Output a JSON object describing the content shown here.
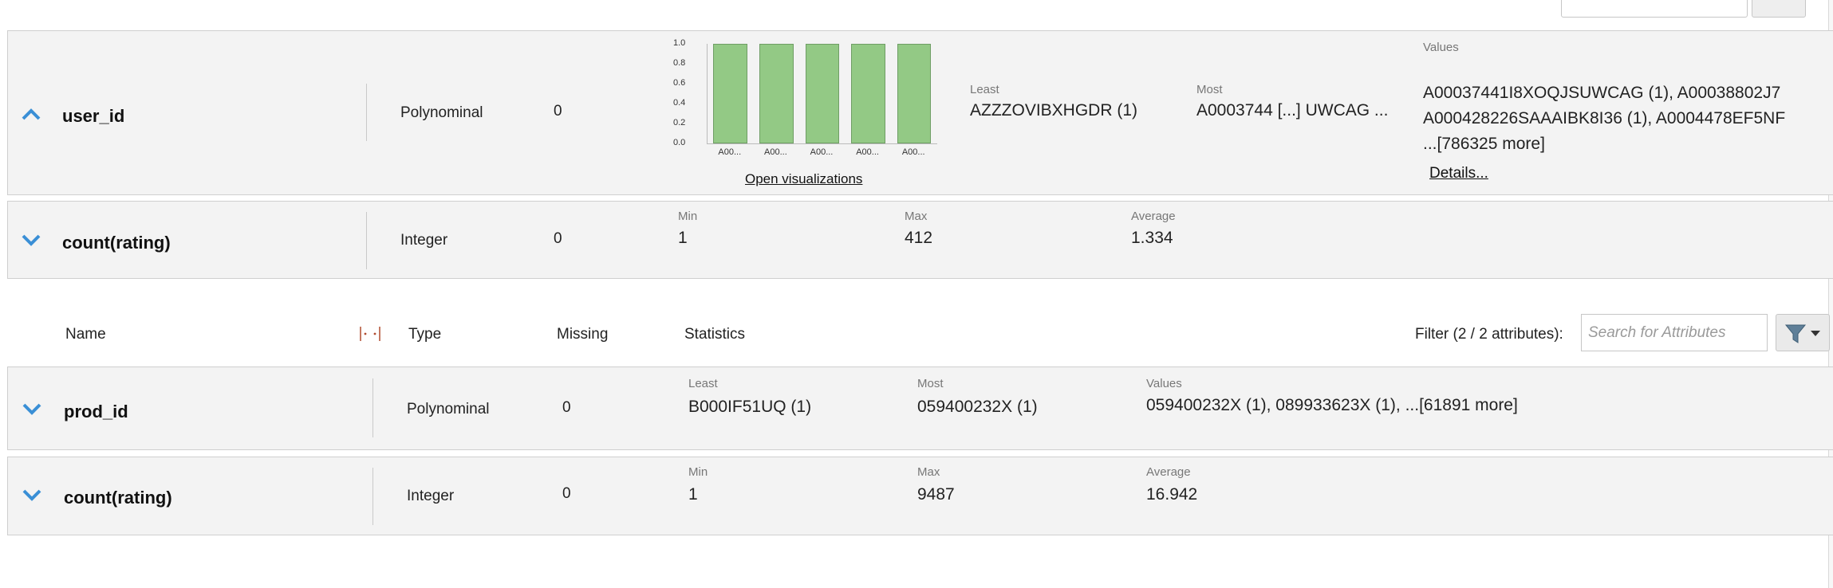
{
  "top_controls": {},
  "attributes_top": [
    {
      "name": "user_id",
      "type": "Polynominal",
      "missing": "0",
      "chart_data": {
        "type": "bar",
        "categories": [
          "A00...",
          "A00...",
          "A00...",
          "A00...",
          "A00..."
        ],
        "values": [
          1.0,
          1.0,
          1.0,
          1.0,
          1.0
        ],
        "ylim": [
          0,
          1.0
        ],
        "yticks": [
          "1.0",
          "0.8",
          "0.6",
          "0.4",
          "0.2",
          "0.0"
        ]
      },
      "open_visualizations": "Open visualizations",
      "least_label": "Least",
      "least_value": "AZZZOVIBXHGDR (1)",
      "most_label": "Most",
      "most_value": "A0003744 [...] UWCAG ...",
      "values_label": "Values",
      "values_line1": "A00037441I8XOQJSUWCAG (1), A00038802J7",
      "values_line2": "A000428226SAAAIBK8I36 (1), A0004478EF5NF",
      "values_line3": "...[786325 more]",
      "details": "Details..."
    },
    {
      "name": "count(rating)",
      "type": "Integer",
      "missing": "0",
      "min_label": "Min",
      "min_value": "1",
      "max_label": "Max",
      "max_value": "412",
      "avg_label": "Average",
      "avg_value": "1.334"
    }
  ],
  "table_header": {
    "name": "Name",
    "type": "Type",
    "missing": "Missing",
    "statistics": "Statistics",
    "filter_label": "Filter (2 / 2 attributes):",
    "search_placeholder": "Search for Attributes"
  },
  "attributes_bottom": [
    {
      "name": "prod_id",
      "type": "Polynominal",
      "missing": "0",
      "least_label": "Least",
      "least_value": "B000IF51UQ (1)",
      "most_label": "Most",
      "most_value": "059400232X (1)",
      "values_label": "Values",
      "values_value": "059400232X (1), 089933623X (1), ...[61891 more]"
    },
    {
      "name": "count(rating)",
      "type": "Integer",
      "missing": "0",
      "min_label": "Min",
      "min_value": "1",
      "max_label": "Max",
      "max_value": "9487",
      "avg_label": "Average",
      "avg_value": "16.942"
    }
  ],
  "colors": {
    "chevron": "#3a8fd6",
    "bar_fill": "#93c985",
    "card_bg": "#f3f3f3"
  }
}
